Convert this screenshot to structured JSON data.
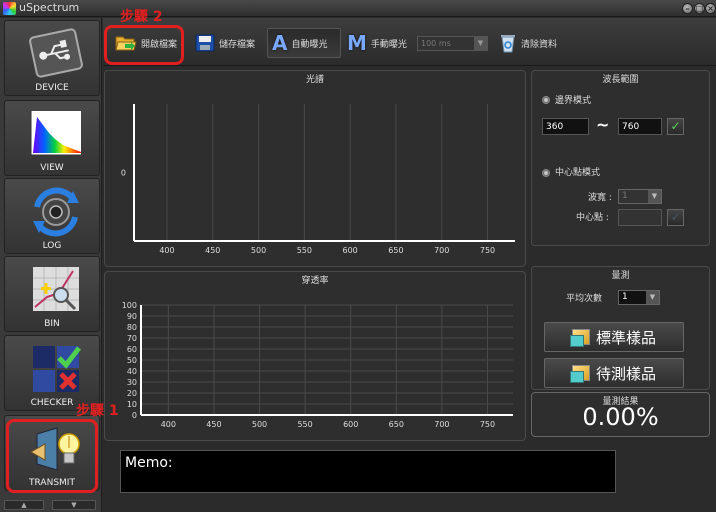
{
  "window": {
    "title": "uSpectrum"
  },
  "sidebar": {
    "items": [
      {
        "label": "DEVICE"
      },
      {
        "label": "VIEW"
      },
      {
        "label": "LOG"
      },
      {
        "label": "BIN"
      },
      {
        "label": "CHECKER"
      },
      {
        "label": "TRANSMIT"
      }
    ]
  },
  "toolbar": {
    "open_label": "開啟檔案",
    "save_label": "儲存檔案",
    "auto_letter": "A",
    "auto_label": "自動曝光",
    "manual_letter": "M",
    "manual_label": "手動曝光",
    "exposure_value": "100 ms",
    "clear_label": "清除資料"
  },
  "spectrum_panel": {
    "title": "光譜"
  },
  "transmit_panel": {
    "title": "穿透率"
  },
  "chart_data": [
    {
      "type": "line",
      "title": "光譜",
      "x_ticks": [
        400,
        450,
        500,
        550,
        600,
        650,
        700,
        750
      ],
      "y_ticks": [
        0
      ],
      "series": [],
      "grid": true
    },
    {
      "type": "line",
      "title": "穿透率",
      "x_ticks": [
        400,
        450,
        500,
        550,
        600,
        650,
        700,
        750
      ],
      "y_ticks": [
        0,
        10,
        20,
        30,
        40,
        50,
        60,
        70,
        80,
        90,
        100
      ],
      "ylim": [
        0,
        100
      ],
      "series": [],
      "grid": true
    }
  ],
  "wavelength_panel": {
    "title": "波長範圍",
    "boundary_mode_label": "邊界模式",
    "min_value": "360",
    "tilde": "~",
    "max_value": "760",
    "center_mode_label": "中心點模式",
    "bandwidth_label": "波寬 :",
    "bandwidth_value": "1",
    "center_label": "中心點 :",
    "center_value": ""
  },
  "measure_panel": {
    "title": "量測",
    "avg_label": "平均次數",
    "avg_value": "1",
    "standard_sample_label": "標準樣品",
    "test_sample_label": "待測樣品"
  },
  "result_panel": {
    "title": "量測結果",
    "value": "0.00%"
  },
  "memo": {
    "label": "Memo:"
  },
  "annotations": {
    "step1": "步驟 1",
    "step2": "步驟 2"
  },
  "colors": {
    "annotation": "#e02020",
    "check": "#5cd65c"
  }
}
